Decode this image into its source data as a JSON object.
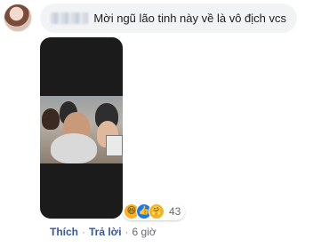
{
  "comment": {
    "author_name": "",
    "text": "Mời ngũ lão tinh này về là vô địch vcs"
  },
  "reactions": {
    "icons": [
      "haha-icon",
      "like-icon",
      "care-icon"
    ],
    "count": "43"
  },
  "actions": {
    "like_label": "Thích",
    "reply_label": "Trả lời",
    "separator": "·",
    "timestamp": "6 giờ"
  },
  "colors": {
    "bubble": "#f2f3f5",
    "link": "#385898",
    "meta": "#65676b",
    "like_blue": "#1877f2",
    "haha_yellow": "#f7b125"
  }
}
